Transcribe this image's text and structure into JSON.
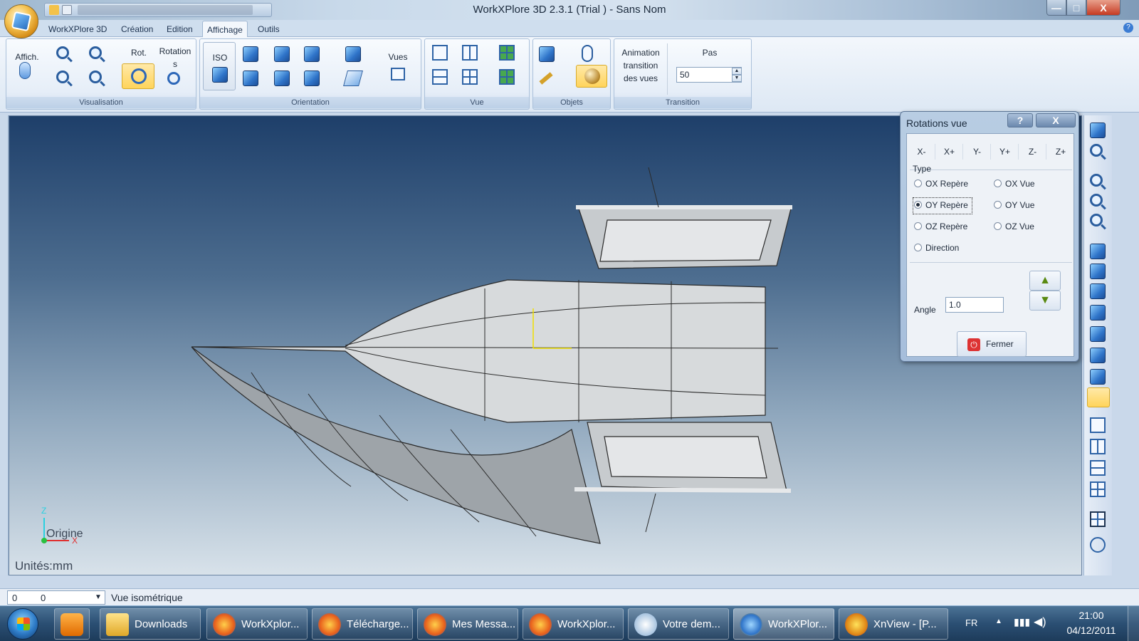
{
  "window": {
    "title": "WorkXPlore 3D 2.3.1 (Trial ) - Sans Nom",
    "controls": {
      "minimize": "—",
      "maximize": "□",
      "close": "X"
    }
  },
  "menu": {
    "tabs": [
      "WorkXPlore 3D",
      "Création",
      "Edition",
      "Affichage",
      "Outils"
    ],
    "active_tab": "Affichage"
  },
  "ribbon": {
    "visualisation": {
      "label": "Visualisation",
      "affich_label": "Affich.",
      "rot_label": "Rot.",
      "rotations_label": "Rotation s"
    },
    "orientation": {
      "label": "Orientation",
      "iso_label": "ISO",
      "vues_label": "Vues"
    },
    "vue": {
      "label": "Vue"
    },
    "objets": {
      "label": "Objets"
    },
    "transition": {
      "label": "Transition",
      "animation_label": "Animation transition des vues",
      "pas_label": "Pas",
      "pas_value": "50"
    }
  },
  "viewport": {
    "units_text": "Unités:mm",
    "origin_text": "Origine",
    "axis_z": "Z",
    "axis_x": "X"
  },
  "dialog": {
    "title": "Rotations vue",
    "help_label": "?",
    "close_label": "X",
    "axis_buttons": [
      "X-",
      "X+",
      "Y-",
      "Y+",
      "Z-",
      "Z+"
    ],
    "type_label": "Type",
    "options": {
      "ox_repere": "OX Repère",
      "ox_vue": "OX Vue",
      "oy_repere": "OY Repère",
      "oy_vue": "OY Vue",
      "oz_repere": "OZ Repère",
      "oz_vue": "OZ Vue",
      "direction": "Direction"
    },
    "selected_option": "OY Repère",
    "angle_label": "Angle",
    "angle_value": "1.0",
    "fermer_label": "Fermer"
  },
  "statusbar": {
    "coord_a": "0",
    "coord_b": "0",
    "view_text": "Vue isométrique"
  },
  "taskbar": {
    "items": [
      {
        "label": "Downloads",
        "icon": "folder-icon"
      },
      {
        "label": "WorkXplor...",
        "icon": "firefox-icon"
      },
      {
        "label": "Télécharge...",
        "icon": "firefox-icon"
      },
      {
        "label": "Mes Messa...",
        "icon": "firefox-icon"
      },
      {
        "label": "WorkXplor...",
        "icon": "firefox-icon"
      },
      {
        "label": "Votre dem...",
        "icon": "mail-icon"
      },
      {
        "label": "WorkXPlor...",
        "icon": "workxplore-icon"
      },
      {
        "label": "XnView - [P...",
        "icon": "xnview-icon"
      }
    ],
    "language": "FR",
    "time": "21:00",
    "date": "04/12/2011"
  },
  "colors": {
    "accent": "#2f74c9",
    "ribbon_bg": "#e6eef8",
    "highlight": "#ffd45b",
    "viewport_top": "#1e3f6a",
    "viewport_bottom": "#d8e2ea"
  }
}
